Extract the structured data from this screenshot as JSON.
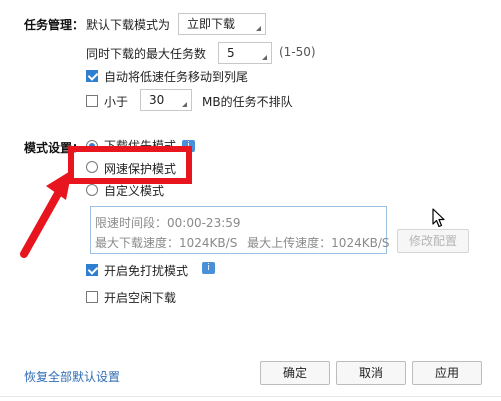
{
  "task": {
    "section_label": "任务管理：",
    "default_mode_label": "默认下载模式为",
    "default_mode_value": "立即下载",
    "max_tasks_label": "同时下载的最大任务数",
    "max_tasks_value": "5",
    "max_tasks_range": "(1-50)",
    "auto_move_label": "自动将低速任务移动到列尾",
    "auto_move_checked": true,
    "small_prefix": "小于",
    "small_value": "30",
    "small_suffix": "MB的任务不排队",
    "small_checked": false
  },
  "mode": {
    "section_label": "模式设置：",
    "options": [
      {
        "label": "下载优先模式",
        "selected": true
      },
      {
        "label": "网速保护模式",
        "selected": false
      },
      {
        "label": "自定义模式",
        "selected": false
      }
    ],
    "speed_limit": {
      "time_label": "限速时间段：",
      "time_value": "00:00-23:59",
      "down_label": "最大下载速度：",
      "down_value": "1024KB/S",
      "up_label": "最大上传速度：",
      "up_value": "1024KB/S"
    },
    "modify_button": "修改配置",
    "no_disturb_label": "开启免打扰模式",
    "no_disturb_checked": true,
    "idle_download_label": "开启空闲下载",
    "idle_download_checked": false
  },
  "footer": {
    "restore_link": "恢复全部默认设置",
    "ok_button": "确定",
    "cancel_button": "取消",
    "apply_button": "应用"
  },
  "colors": {
    "accent": "#2f7fd1",
    "highlight_red": "#e8141e",
    "link": "#2f6db5"
  },
  "icons": {
    "info": "info-icon",
    "cursor": "mouse-pointer-icon"
  }
}
